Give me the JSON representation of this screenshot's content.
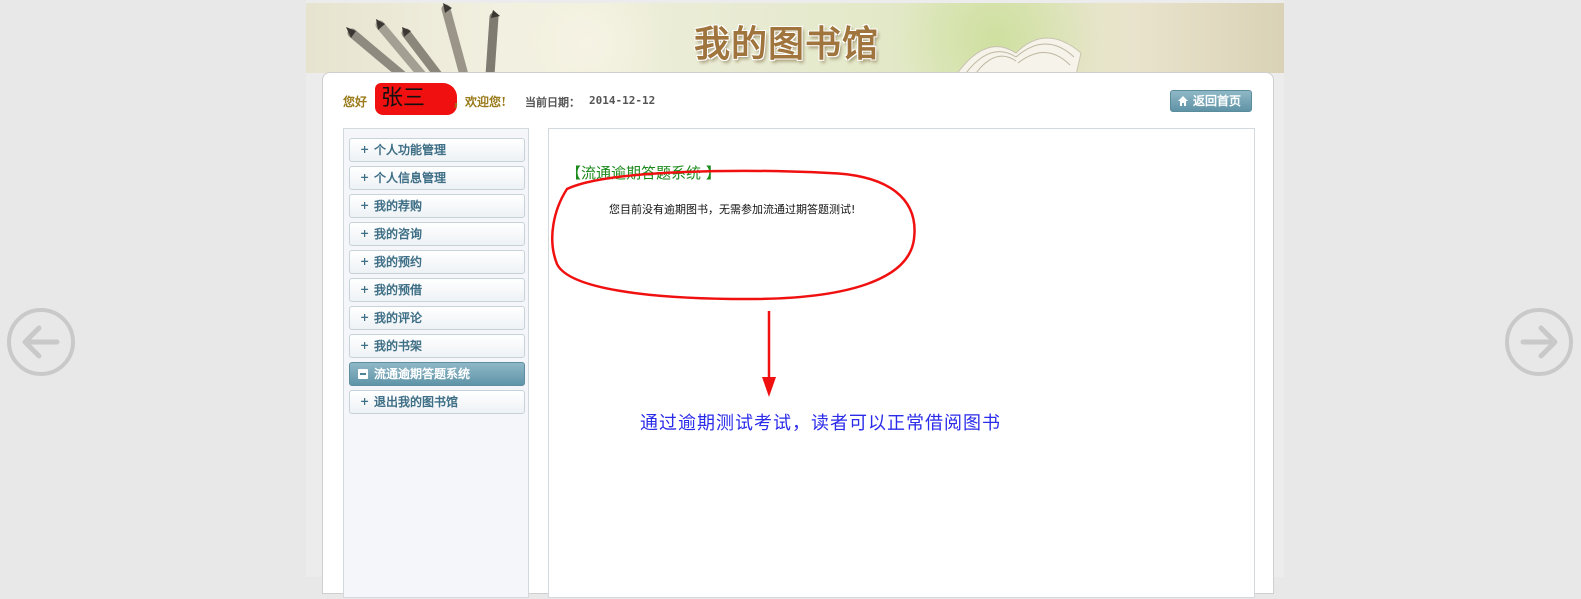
{
  "banner": {
    "title": "我的图书馆"
  },
  "header": {
    "greeting": "您好",
    "username": "张三",
    "welcome": "，欢迎您!",
    "date_label": "当前日期：",
    "date_value": "2014-12-12",
    "home_button": "返回首页"
  },
  "sidebar": {
    "items": [
      {
        "label": "个人功能管理",
        "icon": "plus-icon"
      },
      {
        "label": "个人信息管理",
        "icon": "plus-icon"
      },
      {
        "label": "我的荐购",
        "icon": "plus-icon"
      },
      {
        "label": "我的咨询",
        "icon": "plus-icon"
      },
      {
        "label": "我的预约",
        "icon": "plus-icon"
      },
      {
        "label": "我的预借",
        "icon": "plus-icon"
      },
      {
        "label": "我的评论",
        "icon": "plus-icon"
      },
      {
        "label": "我的书架",
        "icon": "plus-icon"
      },
      {
        "label": "流通逾期答题系统",
        "icon": "minus-icon",
        "active": true
      },
      {
        "label": "退出我的图书馆",
        "icon": "plus-icon"
      }
    ]
  },
  "main": {
    "section_title": "【流通逾期答题系统 】",
    "notice": "您目前没有逾期图书，无需参加流通过期答题测试!",
    "annotation": "通过逾期测试考试，读者可以正常借阅图书"
  },
  "colors": {
    "accent_blue": "#5f94a8",
    "title_green": "#1a8a1a",
    "annotation_blue": "#2b2bea",
    "highlight_red": "#f01010"
  },
  "icons": {
    "prev": "arrow-left-icon",
    "next": "arrow-right-icon",
    "home": "home-icon"
  }
}
